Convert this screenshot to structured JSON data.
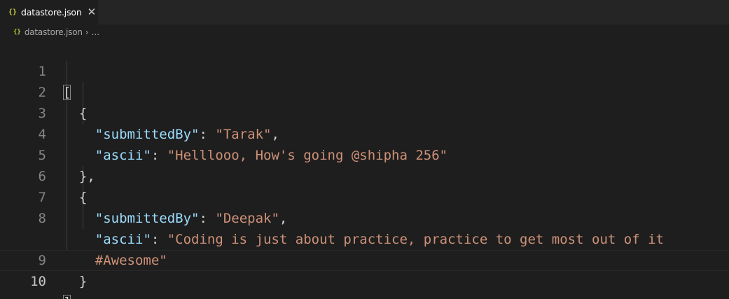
{
  "tab": {
    "icon": "{}",
    "label": "datastore.json",
    "close": "✕"
  },
  "breadcrumb": {
    "icon": "{}",
    "file": "datastore.json",
    "separator": "›",
    "more": "..."
  },
  "editor": {
    "lines": [
      {
        "number": "1",
        "indent": "",
        "open": "["
      },
      {
        "number": "2",
        "indent": "  ",
        "open": "{"
      },
      {
        "number": "3",
        "indent": "    ",
        "key": "\"submittedBy\"",
        "colon": ": ",
        "value": "\"Tarak\"",
        "trail": ","
      },
      {
        "number": "4",
        "indent": "    ",
        "key": "\"ascii\"",
        "colon": ": ",
        "value": "\"Helllooo, How's going @shipha 256\"",
        "trail": ""
      },
      {
        "number": "5",
        "indent": "  ",
        "close": "}",
        "trail": ","
      },
      {
        "number": "6",
        "indent": "  ",
        "open": "{"
      },
      {
        "number": "7",
        "indent": "    ",
        "key": "\"submittedBy\"",
        "colon": ": ",
        "value": "\"Deepak\"",
        "trail": ","
      },
      {
        "number": "8",
        "indent": "    ",
        "key": "\"ascii\"",
        "colon": ": ",
        "value": "\"Coding is just about practice, practice to get most out of it",
        "trail": ""
      },
      {
        "number": "",
        "indent": "    ",
        "value": "#Awesome\"",
        "trail": ""
      },
      {
        "number": "9",
        "indent": "  ",
        "close": "}",
        "trail": ""
      },
      {
        "number": "10",
        "indent": "",
        "close": "]",
        "trail": ""
      }
    ]
  },
  "colors": {
    "background": "#1e1e1e",
    "key": "#9cdcfe",
    "string": "#ce9178",
    "punctuation": "#d4d4d4",
    "line_number": "#858585",
    "json_icon": "#cbcb41"
  }
}
